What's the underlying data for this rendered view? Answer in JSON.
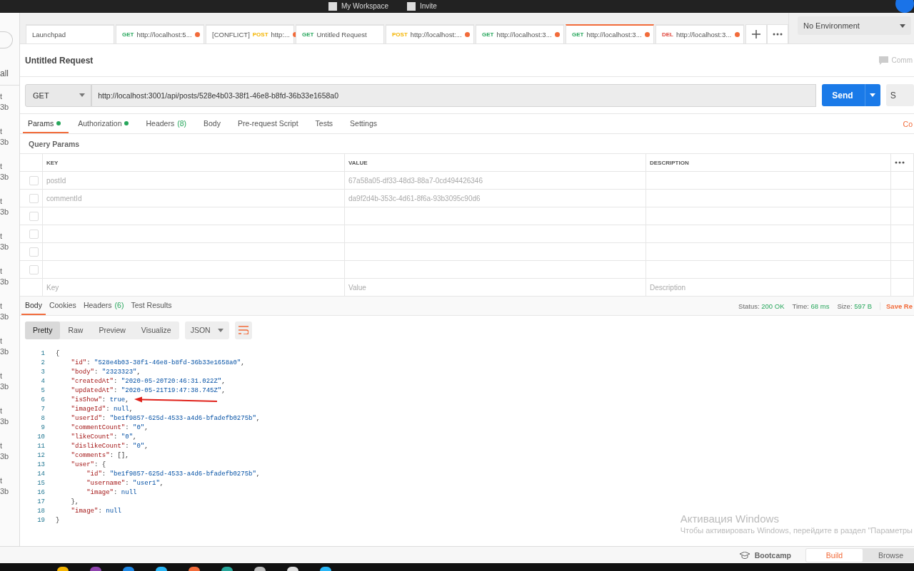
{
  "top_bar": {
    "workspace": "My Workspace",
    "invite": "Invite"
  },
  "sidebar": {
    "filter": "all",
    "items": [
      {
        "line_1": "t",
        "line_2": "3b"
      },
      {
        "line_1": "t",
        "line_2": "3b"
      },
      {
        "line_1": "t",
        "line_2": "3b"
      },
      {
        "line_1": "t",
        "line_2": "3b"
      },
      {
        "line_1": "t",
        "line_2": "3b"
      },
      {
        "line_1": "t",
        "line_2": "3b"
      },
      {
        "line_1": "t",
        "line_2": "3b"
      },
      {
        "line_1": "t",
        "line_2": "3b"
      },
      {
        "line_1": "t",
        "line_2": "3b"
      },
      {
        "line_1": "t",
        "line_2": "3b"
      },
      {
        "line_1": "t",
        "line_2": "3b"
      },
      {
        "line_1": "t",
        "line_2": "3b"
      }
    ]
  },
  "request_tabs": [
    {
      "kind": "page",
      "label": "Launchpad",
      "selected": false,
      "unsaved": false
    },
    {
      "kind": "request",
      "method": {
        "text": "GET",
        "color": "#26a65b"
      },
      "label": "http://localhost:5...",
      "selected": false,
      "unsaved": true
    },
    {
      "kind": "request",
      "prefix": "[CONFLICT]",
      "method": {
        "text": "POST",
        "color": "#f4b400"
      },
      "label": "http:...",
      "selected": false,
      "unsaved": true
    },
    {
      "kind": "request",
      "method": {
        "text": "GET",
        "color": "#26a65b"
      },
      "label": "Untitled Request",
      "selected": false,
      "unsaved": false
    },
    {
      "kind": "request",
      "method": {
        "text": "POST",
        "color": "#f4b400"
      },
      "label": "http://localhost:...",
      "selected": false,
      "unsaved": true
    },
    {
      "kind": "request",
      "method": {
        "text": "GET",
        "color": "#26a65b"
      },
      "label": "http://localhost:3...",
      "selected": false,
      "unsaved": true
    },
    {
      "kind": "request",
      "method": {
        "text": "GET",
        "color": "#26a65b"
      },
      "label": "http://localhost:3...",
      "selected": true,
      "unsaved": true
    },
    {
      "kind": "request",
      "method": {
        "text": "DEL",
        "color": "#e0463c"
      },
      "label": "http://localhost:3...",
      "selected": false,
      "unsaved": true
    }
  ],
  "environment": "No Environment",
  "request": {
    "title": "Untitled Request",
    "comments": "Comm",
    "method": "GET",
    "url": "http://localhost:3001/api/posts/528e4b03-38f1-46e8-b8fd-36b33e1658a0",
    "send": "Send",
    "save": "S"
  },
  "request_sections": [
    {
      "label": "Params",
      "dot": true,
      "selected": true
    },
    {
      "label": "Authorization",
      "dot": true,
      "selected": false
    },
    {
      "label": "Headers",
      "count": "(8)",
      "dot": false,
      "selected": false
    },
    {
      "label": "Body",
      "dot": false,
      "selected": false
    },
    {
      "label": "Pre-request Script",
      "dot": false,
      "selected": false
    },
    {
      "label": "Tests",
      "dot": false,
      "selected": false
    },
    {
      "label": "Settings",
      "dot": false,
      "selected": false
    }
  ],
  "cookies_link": "Co",
  "query_params": {
    "title": "Query Params",
    "columns": [
      "KEY",
      "VALUE",
      "DESCRIPTION"
    ],
    "rows": [
      {
        "key": "postId",
        "value": "67a58a05-df33-48d3-88a7-0cd494426346",
        "checked": false
      },
      {
        "key": "commentId",
        "value": "da9f2d4b-353c-4d61-8f6a-93b3095c90d6",
        "checked": false
      },
      {
        "checked": false
      },
      {
        "checked": false
      },
      {
        "checked": false
      },
      {
        "checked": false
      }
    ],
    "placeholders": {
      "key": "Key",
      "value": "Value",
      "description": "Description"
    }
  },
  "response_tabs": [
    {
      "label": "Body",
      "selected": true
    },
    {
      "label": "Cookies",
      "selected": false
    },
    {
      "label": "Headers",
      "count": "(6)",
      "selected": false
    },
    {
      "label": "Test Results",
      "selected": false
    }
  ],
  "response_stats": [
    {
      "label": "Status:",
      "value": "200 OK"
    },
    {
      "label": "Time:",
      "value": "68 ms"
    },
    {
      "label": "Size:",
      "value": "597 B"
    }
  ],
  "save_response": "Save Re",
  "view_modes": [
    {
      "label": "Pretty",
      "selected": true
    },
    {
      "label": "Raw",
      "selected": false
    },
    {
      "label": "Preview",
      "selected": false
    },
    {
      "label": "Visualize",
      "selected": false
    }
  ],
  "format": "JSON",
  "code_lines": [
    {
      "number": "1",
      "tokens": [
        {
          "kind": "punct",
          "text": "{"
        }
      ]
    },
    {
      "number": "2",
      "tokens": [
        {
          "kind": "key",
          "text": "    \"id\""
        },
        {
          "kind": "punct",
          "text": ": "
        },
        {
          "kind": "string",
          "text": "\"528e4b03-38f1-46e8-b8fd-36b33e1658a0\""
        },
        {
          "kind": "punct",
          "text": ","
        }
      ]
    },
    {
      "number": "3",
      "tokens": [
        {
          "kind": "key",
          "text": "    \"body\""
        },
        {
          "kind": "punct",
          "text": ": "
        },
        {
          "kind": "string",
          "text": "\"2323323\""
        },
        {
          "kind": "punct",
          "text": ","
        }
      ]
    },
    {
      "number": "4",
      "tokens": [
        {
          "kind": "key",
          "text": "    \"createdAt\""
        },
        {
          "kind": "punct",
          "text": ": "
        },
        {
          "kind": "string",
          "text": "\"2020-05-20T20:46:31.022Z\""
        },
        {
          "kind": "punct",
          "text": ","
        }
      ]
    },
    {
      "number": "5",
      "tokens": [
        {
          "kind": "key",
          "text": "    \"updatedAt\""
        },
        {
          "kind": "punct",
          "text": ": "
        },
        {
          "kind": "string",
          "text": "\"2020-05-21T19:47:38.745Z\""
        },
        {
          "kind": "punct",
          "text": ","
        }
      ]
    },
    {
      "number": "6",
      "tokens": [
        {
          "kind": "key",
          "text": "    \"isShow\""
        },
        {
          "kind": "punct",
          "text": ": "
        },
        {
          "kind": "literal",
          "text": "true"
        },
        {
          "kind": "punct",
          "text": ","
        }
      ]
    },
    {
      "number": "7",
      "tokens": [
        {
          "kind": "key",
          "text": "    \"imageId\""
        },
        {
          "kind": "punct",
          "text": ": "
        },
        {
          "kind": "literal",
          "text": "null"
        },
        {
          "kind": "punct",
          "text": ","
        }
      ]
    },
    {
      "number": "8",
      "tokens": [
        {
          "kind": "key",
          "text": "    \"userId\""
        },
        {
          "kind": "punct",
          "text": ": "
        },
        {
          "kind": "string",
          "text": "\"be1f9857-625d-4533-a4d6-bfadefb0275b\""
        },
        {
          "kind": "punct",
          "text": ","
        }
      ]
    },
    {
      "number": "9",
      "tokens": [
        {
          "kind": "key",
          "text": "    \"commentCount\""
        },
        {
          "kind": "punct",
          "text": ": "
        },
        {
          "kind": "string",
          "text": "\"0\""
        },
        {
          "kind": "punct",
          "text": ","
        }
      ]
    },
    {
      "number": "10",
      "tokens": [
        {
          "kind": "key",
          "text": "    \"likeCount\""
        },
        {
          "kind": "punct",
          "text": ": "
        },
        {
          "kind": "string",
          "text": "\"0\""
        },
        {
          "kind": "punct",
          "text": ","
        }
      ]
    },
    {
      "number": "11",
      "tokens": [
        {
          "kind": "key",
          "text": "    \"dislikeCount\""
        },
        {
          "kind": "punct",
          "text": ": "
        },
        {
          "kind": "string",
          "text": "\"0\""
        },
        {
          "kind": "punct",
          "text": ","
        }
      ]
    },
    {
      "number": "12",
      "tokens": [
        {
          "kind": "key",
          "text": "    \"comments\""
        },
        {
          "kind": "punct",
          "text": ": [],"
        }
      ]
    },
    {
      "number": "13",
      "tokens": [
        {
          "kind": "key",
          "text": "    \"user\""
        },
        {
          "kind": "punct",
          "text": ": {"
        }
      ]
    },
    {
      "number": "14",
      "tokens": [
        {
          "kind": "key",
          "text": "        \"id\""
        },
        {
          "kind": "punct",
          "text": ": "
        },
        {
          "kind": "string",
          "text": "\"be1f9857-625d-4533-a4d6-bfadefb0275b\""
        },
        {
          "kind": "punct",
          "text": ","
        }
      ]
    },
    {
      "number": "15",
      "tokens": [
        {
          "kind": "key",
          "text": "        \"username\""
        },
        {
          "kind": "punct",
          "text": ": "
        },
        {
          "kind": "string",
          "text": "\"user1\""
        },
        {
          "kind": "punct",
          "text": ","
        }
      ]
    },
    {
      "number": "16",
      "tokens": [
        {
          "kind": "key",
          "text": "        \"image\""
        },
        {
          "kind": "punct",
          "text": ": "
        },
        {
          "kind": "literal",
          "text": "null"
        }
      ]
    },
    {
      "number": "17",
      "tokens": [
        {
          "kind": "punct",
          "text": "    },"
        }
      ]
    },
    {
      "number": "18",
      "tokens": [
        {
          "kind": "key",
          "text": "    \"image\""
        },
        {
          "kind": "punct",
          "text": ": "
        },
        {
          "kind": "literal",
          "text": "null"
        }
      ]
    },
    {
      "number": "19",
      "tokens": [
        {
          "kind": "punct",
          "text": "}"
        }
      ]
    }
  ],
  "annotations": [
    {
      "kind": "arrow"
    }
  ],
  "activation_notice": {
    "title": "Активация Windows",
    "text": "Чтобы активировать Windows, перейдите в раздел \"Параметры"
  },
  "footer": {
    "bootcamp": "Bootcamp",
    "modes": [
      {
        "label": "Build",
        "selected": true
      },
      {
        "label": "Browse",
        "selected": false
      }
    ]
  }
}
